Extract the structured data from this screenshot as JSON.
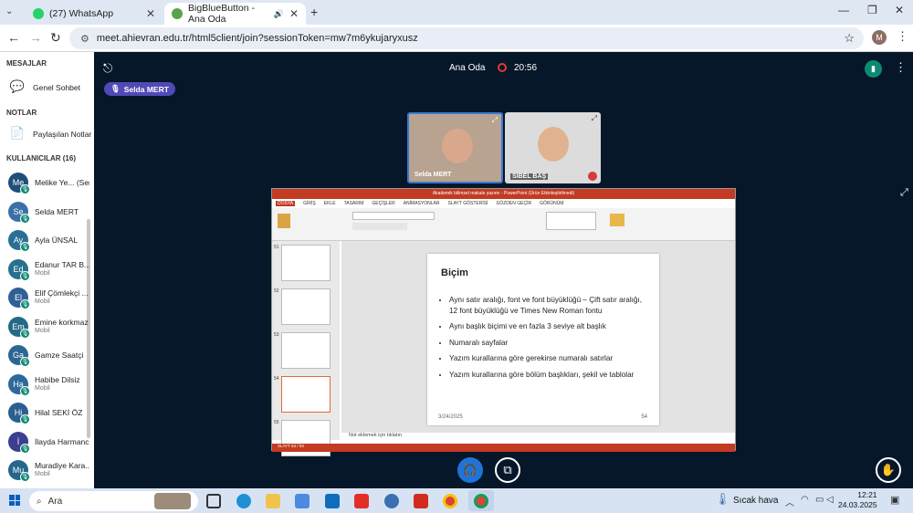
{
  "browser": {
    "tabs": [
      {
        "title": "(27) WhatsApp"
      },
      {
        "title": "BigBlueButton - Ana Oda"
      }
    ],
    "url": "meet.ahievran.edu.tr/html5client/join?sessionToken=mw7m6ykujaryxusz",
    "profile_initial": "M"
  },
  "sidebar": {
    "messages_header": "MESAJLAR",
    "public_chat": "Genel Sohbet",
    "notes_header": "NOTLAR",
    "shared_notes": "Paylaşılan Notlar",
    "users_header": "KULLANICILAR (16)",
    "users": [
      {
        "initials": "Me",
        "name": "Melike Ye... (Sen)",
        "sub": "",
        "color": "#1f4e7a"
      },
      {
        "initials": "Se",
        "name": "Selda MERT",
        "sub": "",
        "color": "#3b6fa8"
      },
      {
        "initials": "Ay",
        "name": "Ayla ÜNSAL",
        "sub": "",
        "color": "#2a6f96"
      },
      {
        "initials": "Ed",
        "name": "Edanur TAR B...",
        "sub": "Mobil",
        "color": "#28708e"
      },
      {
        "initials": "El",
        "name": "Elif Çömlekçi ...",
        "sub": "Mobil",
        "color": "#2f5f97"
      },
      {
        "initials": "Em",
        "name": "Emine korkmaz",
        "sub": "Mobil",
        "color": "#246a86"
      },
      {
        "initials": "Ga",
        "name": "Gamze Saatçi",
        "sub": "",
        "color": "#2b6792"
      },
      {
        "initials": "Ha",
        "name": "Habibe Dilsiz",
        "sub": "Mobil",
        "color": "#2d6a9b"
      },
      {
        "initials": "Hi",
        "name": "Hilal SEKİ ÖZ",
        "sub": "",
        "color": "#2a5f8f"
      },
      {
        "initials": "İ",
        "name": "İlayda Harmancı",
        "sub": "",
        "color": "#3a3f8f"
      },
      {
        "initials": "Mu",
        "name": "Muradiye Kara...",
        "sub": "Mobil",
        "color": "#24678a"
      }
    ]
  },
  "meeting": {
    "room_name": "Ana Oda",
    "timer": "20:56",
    "talker": "Selda MERT",
    "videos": [
      {
        "name": "Selda MERT"
      },
      {
        "name": "SİBEL BAŞ"
      }
    ]
  },
  "presentation": {
    "window_title": "Akademik bilimsel makale yazımı - PowerPoint (Ürün Etkinleştirilmedi)",
    "ribbon_tabs": [
      "DOSYA",
      "GİRİŞ",
      "EKLE",
      "TASARIM",
      "GEÇİŞLER",
      "ANİMASYONLAR",
      "SLAYT GÖSTERİSİ",
      "GÖZDEN GEÇİR",
      "GÖRÜNÜM"
    ],
    "thumb_numbers": [
      "51",
      "52",
      "53",
      "54",
      "55"
    ],
    "slide": {
      "title": "Biçim",
      "bullets": [
        "Aynı satır aralığı, font ve font büyüklüğü – Çift satır aralığı, 12 font büyüklüğü ve Times New Roman fontu",
        "Aynı başlık biçimi ve en fazla 3 seviye alt başlık",
        "Numaralı sayfalar",
        "Yazım kurallarına göre gerekirse numaralı satırlar",
        "Yazım kurallarına göre bölüm başlıkları, şekil ve tablolar"
      ],
      "date": "3/24/2025",
      "number": "54"
    },
    "notes_placeholder": "Not eklemek için tıklatın",
    "status": "SLAYT 54 / 93"
  },
  "taskbar": {
    "search_placeholder": "Ara",
    "weather": "Sıcak hava",
    "time": "12:21",
    "date": "24.03.2025"
  }
}
